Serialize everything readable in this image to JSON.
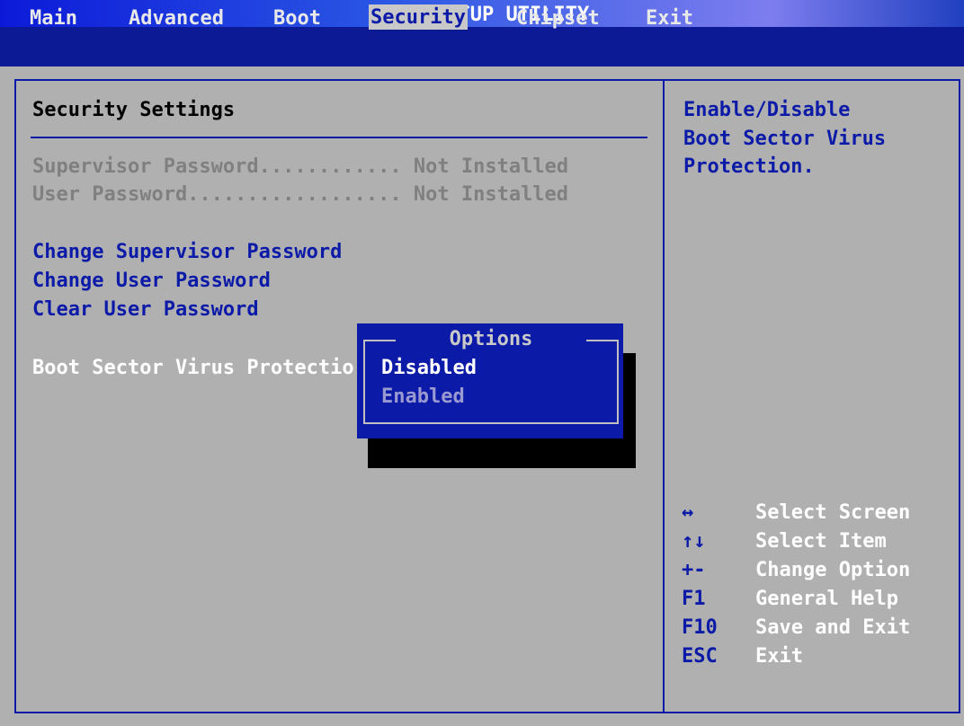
{
  "title": "BIOS SETUP UTILITY",
  "menu": [
    "Main",
    "Advanced",
    "Boot",
    "Security",
    "Chipset",
    "Exit"
  ],
  "active_menu": "Security",
  "section_title": "Security Settings",
  "status_rows": [
    {
      "label": "Supervisor Password",
      "dots": "............",
      "value": "Not Installed"
    },
    {
      "label": "User Password",
      "dots": "..................",
      "value": "Not Installed"
    }
  ],
  "actions": [
    "Change Supervisor Password",
    "Change User Password",
    "Clear User Password"
  ],
  "boot_sector_label": "Boot Sector Virus Protectio",
  "popup": {
    "title": "Options",
    "options": [
      "Disabled",
      "Enabled"
    ],
    "selected": "Disabled"
  },
  "help_text": [
    "Enable/Disable",
    "Boot Sector Virus",
    "Protection."
  ],
  "key_help": [
    {
      "key": "↔",
      "desc": "Select Screen"
    },
    {
      "key": "↑↓",
      "desc": "Select Item"
    },
    {
      "key": "+-",
      "desc": "Change Option"
    },
    {
      "key": "F1",
      "desc": "General Help"
    },
    {
      "key": "F10",
      "desc": "Save and Exit"
    },
    {
      "key": "ESC",
      "desc": "Exit"
    }
  ],
  "colors": {
    "bios_blue": "#0c1aa8",
    "background": "#b0b0b0",
    "dim_text": "#808080"
  }
}
